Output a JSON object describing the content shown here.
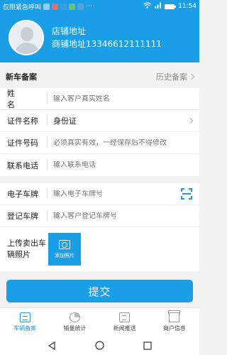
{
  "statusbar": {
    "left_text": "仅限紧急呼叫",
    "time": "11:54"
  },
  "header": {
    "shop_name": "店铺地址",
    "shop_address": "商铺地址13346612111111"
  },
  "section": {
    "title": "新车备案",
    "history_label": "历史备案"
  },
  "form": {
    "name": {
      "label": "姓  名",
      "placeholder": "输入客户真实姓名"
    },
    "id_type": {
      "label": "证件名称",
      "value": "身份证"
    },
    "id_number": {
      "label": "证件号码",
      "placeholder": "必须真实有效，一经保存后不得修改"
    },
    "phone": {
      "label": "联系电话",
      "placeholder": "输入联系电话"
    },
    "e_plate": {
      "label": "电子车牌",
      "placeholder": "输入电子车牌号"
    },
    "reg_plate": {
      "label": "登记车牌",
      "placeholder": "输入客户登记车牌号"
    },
    "photo": {
      "label": "上传卖出车辆照片",
      "button": "添加照片"
    }
  },
  "submit_label": "提交",
  "tabs": [
    {
      "label": "车辆备案"
    },
    {
      "label": "销量统计"
    },
    {
      "label": "新闻推送"
    },
    {
      "label": "商户信息"
    }
  ],
  "colors": {
    "accent": "#1a9ee6"
  }
}
